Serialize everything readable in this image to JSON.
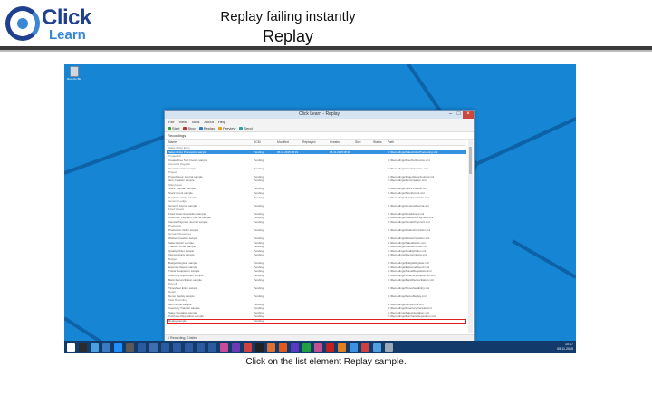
{
  "header": {
    "logo_word1": "Click",
    "logo_word2": "Learn",
    "title": "Replay failing instantly",
    "subtitle": "Replay"
  },
  "colors": {
    "desktop_blue": "#1686d4",
    "taskbar": "#123a6b",
    "selection": "#3592e0",
    "highlight_border": "#e02020",
    "logo_dark": "#1f3f8f",
    "logo_light": "#3a87d6"
  },
  "desktop": {
    "recycle_bin_label": "Recycle Bin"
  },
  "window": {
    "title": "Click Learn - Replay",
    "menu": [
      "File",
      "View",
      "Tools",
      "About",
      "Help"
    ],
    "toolbar": [
      "Start",
      "Stop",
      "Replay",
      "Preview",
      "Send"
    ],
    "section_label": "Recordings",
    "columns": [
      "Name",
      "SCM",
      "Modified",
      "Replayed",
      "Created",
      "Size",
      "Status",
      "Path"
    ],
    "rows": [
      {
        "name": "Sales Order Entry",
        "type": "group"
      },
      {
        "name": "Sales Order Processing sample",
        "scm": "Pending",
        "modified": "05.11.2015 08:33",
        "replayed": "",
        "created": "05.11.2015 08:30",
        "size": "",
        "status": "",
        "path": "C:\\Recordings\\SalesOrderProcessing.xml",
        "type": "selected"
      },
      {
        "name": "Create FO",
        "type": "group"
      },
      {
        "name": "Create Free Text Invoice sample",
        "scm": "Pending",
        "modified": "",
        "replayed": "",
        "created": "",
        "size": "",
        "status": "",
        "path": "C:\\Recordings\\FreeTextInvoice.xml",
        "type": "row"
      },
      {
        "name": "Accounts Payable",
        "type": "group"
      },
      {
        "name": "Vendor Invoice sample",
        "scm": "Pending",
        "modified": "",
        "replayed": "",
        "created": "",
        "size": "",
        "status": "",
        "path": "C:\\Recordings\\VendorInvoice.xml",
        "type": "row"
      },
      {
        "name": "Project",
        "type": "group"
      },
      {
        "name": "Project Hour Journal sample",
        "scm": "Pending",
        "modified": "",
        "replayed": "",
        "created": "",
        "size": "",
        "status": "",
        "path": "C:\\Recordings\\ProjectHourJournal.xml",
        "type": "row"
      },
      {
        "name": "Item Creation sample",
        "scm": "Pending",
        "modified": "",
        "replayed": "",
        "created": "",
        "size": "",
        "status": "",
        "path": "C:\\Recordings\\ItemCreation.xml",
        "type": "row"
      },
      {
        "name": "Warehouse",
        "type": "group"
      },
      {
        "name": "Stock Transfer sample",
        "scm": "Pending",
        "modified": "",
        "replayed": "",
        "created": "",
        "size": "",
        "status": "",
        "path": "C:\\Recordings\\StockTransfer.xml",
        "type": "row"
      },
      {
        "name": "Stock Count sample",
        "scm": "Pending",
        "modified": "",
        "replayed": "",
        "created": "",
        "size": "",
        "status": "",
        "path": "C:\\Recordings\\StockCount.xml",
        "type": "row"
      },
      {
        "name": "Purchase Order sample",
        "scm": "Pending",
        "modified": "",
        "replayed": "",
        "created": "",
        "size": "",
        "status": "",
        "path": "C:\\Recordings\\PurchaseOrder.xml",
        "type": "row"
      },
      {
        "name": "General Ledger",
        "type": "group"
      },
      {
        "name": "General Journal sample",
        "scm": "Pending",
        "modified": "",
        "replayed": "",
        "created": "",
        "size": "",
        "status": "",
        "path": "C:\\Recordings\\GeneralJournal.xml",
        "type": "row"
      },
      {
        "name": "Fixed Assets",
        "type": "group"
      },
      {
        "name": "Fixed Asset Acquisition sample",
        "scm": "Pending",
        "modified": "",
        "replayed": "",
        "created": "",
        "size": "",
        "status": "",
        "path": "C:\\Recordings\\FixedAsset.xml",
        "type": "row"
      },
      {
        "name": "Customer Payment Journal sample",
        "scm": "Pending",
        "modified": "",
        "replayed": "",
        "created": "",
        "size": "",
        "status": "",
        "path": "C:\\Recordings\\CustomerPayment.xml",
        "type": "row"
      },
      {
        "name": "Vendor Payment Journal sample",
        "scm": "Pending",
        "modified": "",
        "replayed": "",
        "created": "",
        "size": "",
        "status": "",
        "path": "C:\\Recordings\\VendorPayment.xml",
        "type": "row"
      },
      {
        "name": "Production",
        "type": "group"
      },
      {
        "name": "Production Order sample",
        "scm": "Pending",
        "modified": "",
        "replayed": "",
        "created": "",
        "size": "",
        "status": "",
        "path": "C:\\Recordings\\ProductionOrder.xml",
        "type": "row"
      },
      {
        "name": "Human Resources",
        "type": "group"
      },
      {
        "name": "Worker Creation sample",
        "scm": "Pending",
        "modified": "",
        "replayed": "",
        "created": "",
        "size": "",
        "status": "",
        "path": "C:\\Recordings\\WorkerCreation.xml",
        "type": "row"
      },
      {
        "name": "Sales Return sample",
        "scm": "Pending",
        "modified": "",
        "replayed": "",
        "created": "",
        "size": "",
        "status": "",
        "path": "C:\\Recordings\\SalesReturn.xml",
        "type": "row"
      },
      {
        "name": "Transfer Order sample",
        "scm": "Pending",
        "modified": "",
        "replayed": "",
        "created": "",
        "size": "",
        "status": "",
        "path": "C:\\Recordings\\TransferOrder.xml",
        "type": "row"
      },
      {
        "name": "Quality Order sample",
        "scm": "Pending",
        "modified": "",
        "replayed": "",
        "created": "",
        "size": "",
        "status": "",
        "path": "C:\\Recordings\\QualityOrder.xml",
        "type": "row"
      },
      {
        "name": "Intercompany sample",
        "scm": "Pending",
        "modified": "",
        "replayed": "",
        "created": "",
        "size": "",
        "status": "",
        "path": "C:\\Recordings\\Intercompany.xml",
        "type": "row"
      },
      {
        "name": "Budget",
        "type": "group"
      },
      {
        "name": "Budget Register sample",
        "scm": "Pending",
        "modified": "",
        "replayed": "",
        "created": "",
        "size": "",
        "status": "",
        "path": "C:\\Recordings\\BudgetRegister.xml",
        "type": "row"
      },
      {
        "name": "Expense Report sample",
        "scm": "Pending",
        "modified": "",
        "replayed": "",
        "created": "",
        "size": "",
        "status": "",
        "path": "C:\\Recordings\\ExpenseReport.xml",
        "type": "row"
      },
      {
        "name": "Travel Requisition sample",
        "scm": "Pending",
        "modified": "",
        "replayed": "",
        "created": "",
        "size": "",
        "status": "",
        "path": "C:\\Recordings\\TravelRequisition.xml",
        "type": "row"
      },
      {
        "name": "Inventory Adjustment sample",
        "scm": "Pending",
        "modified": "",
        "replayed": "",
        "created": "",
        "size": "",
        "status": "",
        "path": "C:\\Recordings\\InventoryAdjustment.xml",
        "type": "row"
      },
      {
        "name": "Bank Reconciliation sample",
        "scm": "Pending",
        "modified": "",
        "replayed": "",
        "created": "",
        "size": "",
        "status": "",
        "path": "C:\\Recordings\\BankReconciliation.xml",
        "type": "row"
      },
      {
        "name": "Payroll",
        "type": "group"
      },
      {
        "name": "Timesheet Entry sample",
        "scm": "Pending",
        "modified": "",
        "replayed": "",
        "created": "",
        "size": "",
        "status": "",
        "path": "C:\\Recordings\\TimesheetEntry.xml",
        "type": "row"
      },
      {
        "name": "Retail",
        "type": "group"
      },
      {
        "name": "Demo Replay sample",
        "scm": "Pending",
        "modified": "",
        "replayed": "",
        "created": "",
        "size": "",
        "status": "",
        "path": "C:\\Recordings\\DemoReplay.xml",
        "type": "row"
      },
      {
        "name": "Task Recording",
        "type": "group"
      },
      {
        "name": "Item Arrival sample",
        "scm": "Pending",
        "modified": "",
        "replayed": "",
        "created": "",
        "size": "",
        "status": "",
        "path": "C:\\Recordings\\ItemArrival.xml",
        "type": "row"
      },
      {
        "name": "Inventory Transfer sample",
        "scm": "Pending",
        "modified": "",
        "replayed": "",
        "created": "",
        "size": "",
        "status": "",
        "path": "C:\\Recordings\\InventoryTransfer.xml",
        "type": "row"
      },
      {
        "name": "Sales Quotation sample",
        "scm": "Pending",
        "modified": "",
        "replayed": "",
        "created": "",
        "size": "",
        "status": "",
        "path": "C:\\Recordings\\SalesQuotation.xml",
        "type": "row"
      },
      {
        "name": "Purchase Requisition sample",
        "scm": "Pending",
        "modified": "",
        "replayed": "",
        "created": "",
        "size": "",
        "status": "",
        "path": "C:\\Recordings\\PurchaseRequisition.xml",
        "type": "row"
      },
      {
        "name": "Replay sample",
        "scm": "Pending",
        "modified": "",
        "replayed": "",
        "created": "",
        "size": "",
        "status": "",
        "path": "",
        "type": "highlight"
      }
    ],
    "status_text": "1 Recording, 0 failed"
  },
  "taskbar": {
    "clock": "10:17",
    "date": "05.11.2015",
    "icon_colors": [
      "#ffffff",
      "#2b2b2b",
      "#4aa0e0",
      "#3a7ac0",
      "#1e90ff",
      "#5a5a5a",
      "#2c5aa0",
      "#3f6fb0",
      "#2c5aa0",
      "#2c5aa0",
      "#2c5aa0",
      "#2c5aa0",
      "#2c5aa0",
      "#c94a9a",
      "#6a3ab0",
      "#d04040",
      "#222222",
      "#e07030",
      "#e05a20",
      "#5a3ac0",
      "#20a040",
      "#c05090",
      "#c02020",
      "#e08020",
      "#4090e0",
      "#d04040",
      "#50a0e0",
      "#9aa8b8"
    ]
  },
  "caption": "Click on the list element Replay sample."
}
